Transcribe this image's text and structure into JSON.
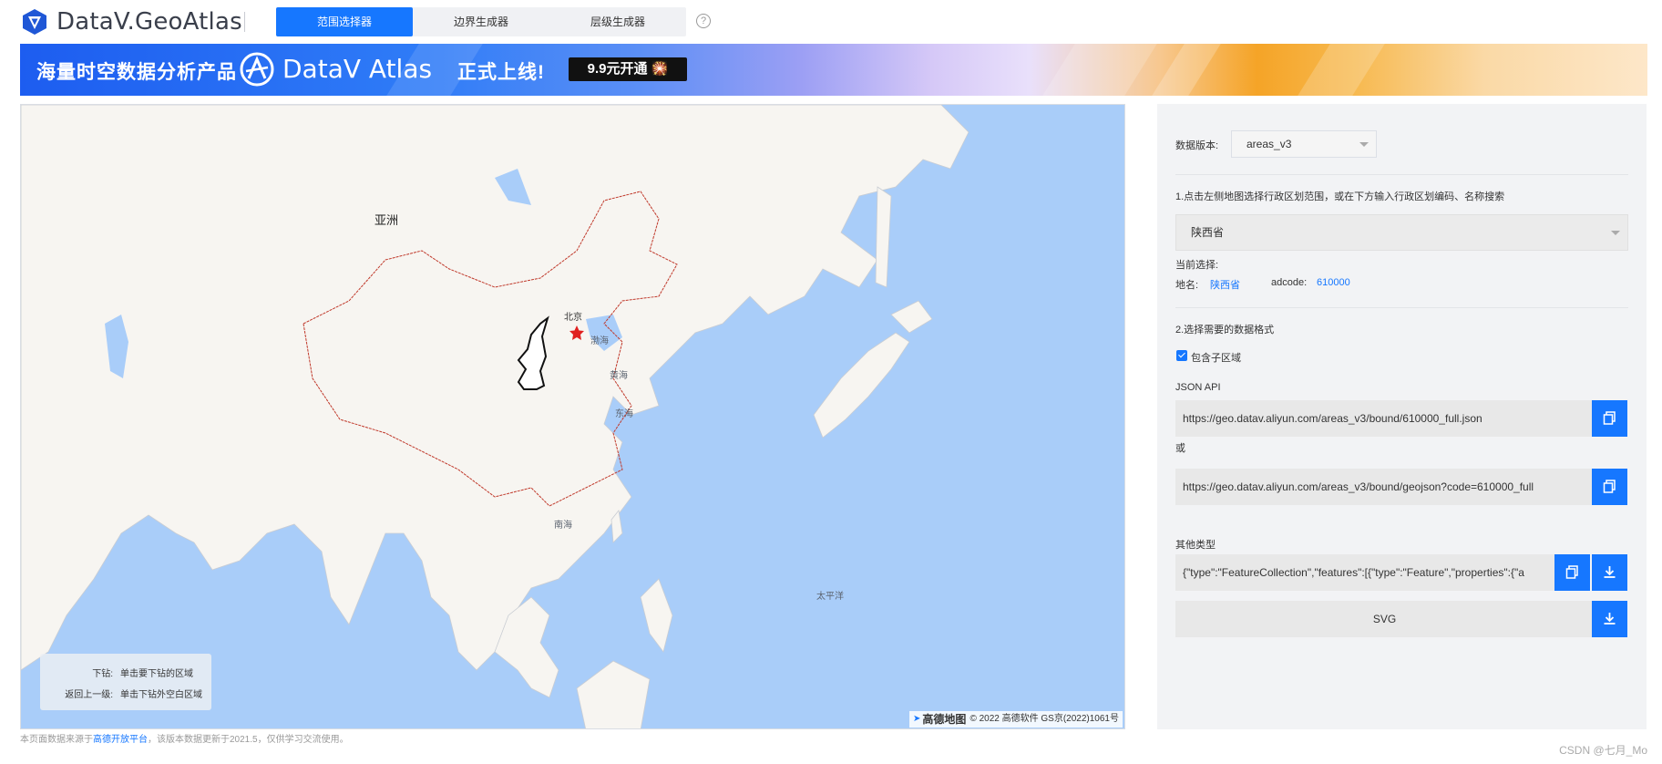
{
  "header": {
    "logo_text": "DataV.GeoAtlas",
    "tabs": [
      {
        "label": "范围选择器",
        "active": true
      },
      {
        "label": "边界生成器",
        "active": false
      },
      {
        "label": "层级生成器",
        "active": false
      }
    ],
    "help_icon": "?"
  },
  "banner": {
    "tagline": "海量时空数据分析产品",
    "product": "DataV Atlas",
    "launch": "正式上线!",
    "cta": "9.9元开通 🎇"
  },
  "map": {
    "labels": {
      "asia": "亚洲",
      "beijing": "北京",
      "bohai": "渤海",
      "yellow_sea": "黄海",
      "east_sea": "东海",
      "south_sea": "南海",
      "pacific": "太平洋"
    },
    "legend": [
      {
        "key": "下钻:",
        "value": "单击要下钻的区域"
      },
      {
        "key": "返回上一级:",
        "value": "单击下钻外空白区域"
      }
    ],
    "attribution_brand": "高德地图",
    "attribution_text": "© 2022 高德软件 GS京(2022)1061号"
  },
  "panel": {
    "version_label": "数据版本:",
    "version_value": "areas_v3",
    "step1": "1.点击左侧地图选择行政区划范围，或在下方输入行政区划编码、名称搜索",
    "region_select": "陕西省",
    "current_label": "当前选择:",
    "name_label": "地名:",
    "name_value": "陕西省",
    "adcode_label": "adcode:",
    "adcode_value": "610000",
    "step2": "2.选择需要的数据格式",
    "include_children": "包含子区域",
    "json_api_label": "JSON API",
    "json_api_url": "https://geo.datav.aliyun.com/areas_v3/bound/610000_full.json",
    "or_label": "或",
    "geojson_url": "https://geo.datav.aliyun.com/areas_v3/bound/geojson?code=610000_full",
    "other_label": "其他类型",
    "other_value": "{\"type\":\"FeatureCollection\",\"features\":[{\"type\":\"Feature\",\"properties\":{\"a",
    "svg_label": "SVG"
  },
  "footer": {
    "pre": "本页面数据来源于",
    "link": "高德开放平台",
    "post": "，该版本数据更新于2021.5，仅供学习交流使用。"
  },
  "watermark": "CSDN @七月_Mo",
  "colors": {
    "accent": "#1677ff",
    "ocean": "#a9cdf9",
    "land": "#f7f5f1",
    "border": "#c0392b"
  }
}
